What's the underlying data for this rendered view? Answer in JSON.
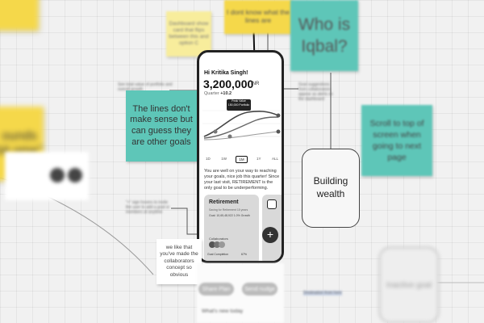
{
  "stickies": {
    "dashboard_card": "Dashboard show card that flips between this and option C",
    "dont_know": "I dont know what the lines are",
    "who_is": "Who is Iqbal?",
    "lines_dont_make_sense": "The lines don't make sense but can guess they are other goals",
    "scroll_to_top": "Scroll to top of screen when going to next page",
    "sounds_partial": "ounds bit ome\"",
    "like_collaborators": "we like that you've made the collaborators concept so obvious"
  },
  "annotations": {
    "total_value": "See total value of portfolio and overall growth",
    "goal_suggestions": "Goal suggestions from collaborators appear as alerts on the dashboard",
    "icon_invite": "\"+\" sign hovers to invite the user to add a goal or members at anytime",
    "destination": "Destination from here"
  },
  "phone": {
    "greeting": "Hi Kritika Singh!",
    "amount": "3,200,000",
    "currency": "INR",
    "quarter_label": "Quarter",
    "quarter_change": "+10.2",
    "chip_top": "Peak Value",
    "chip_value": "150,000 Portfolio",
    "timeframes": [
      "1D",
      "1W",
      "1M",
      "1Y",
      "ALL"
    ],
    "description": "You are well on your way to reaching your goals, nice job this quarter! Since your last visit, RETIREMENT is the only goal to be underperforming.",
    "card_title": "Retirement",
    "card_sub": "Saving for Retirement 15 years",
    "card_meta": "Goal: 10,65,48,922  1.0% Growth",
    "collab_label": "Collaborators",
    "goal_completion": "Goal Completion",
    "goal_pct": "67%",
    "fab_icon": "+"
  },
  "buttons": {
    "share_plan": "Share Plan",
    "send_nudge": "Send nudge"
  },
  "whats_new": "What's new today",
  "frames": {
    "building_wealth": "Building wealth",
    "inactive_goal": "Inactive goal"
  },
  "colors": {
    "sticky_yellow": "#f5d84a",
    "sticky_teal": "#5ec6b8",
    "phone_border": "#222222",
    "canvas": "#f1f1f1"
  }
}
